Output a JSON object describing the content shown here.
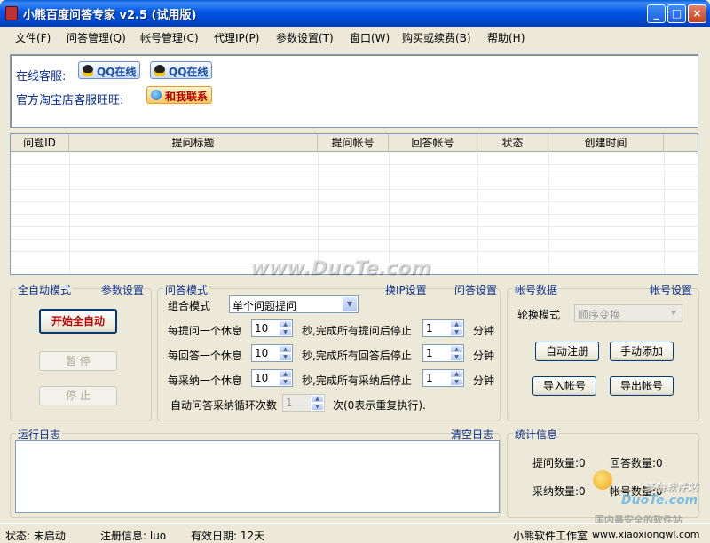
{
  "window": {
    "title": "小熊百度问答专家 v2.5 (试用版)",
    "minimize": "_",
    "maximize": "□",
    "close": "×"
  },
  "menu": [
    "文件(F)",
    "问答管理(Q)",
    "帐号管理(C)",
    "代理IP(P)",
    "参数设置(T)",
    "窗口(W)",
    "购买或续费(B)",
    "帮助(H)"
  ],
  "support": {
    "online_label": "在线客服:",
    "qq1": "QQ在线",
    "qq2": "QQ在线",
    "taobao_label": "官方淘宝店客服旺旺:",
    "wangwang": "和我联系"
  },
  "table": {
    "columns": [
      "问题ID",
      "提问标题",
      "提问帐号",
      "回答帐号",
      "状态",
      "创建时间"
    ]
  },
  "auto_mode": {
    "title": "全自动模式",
    "params_link": "参数设置",
    "start": "开始全自动",
    "pause": "暂  停",
    "stop": "停  止"
  },
  "qa_mode": {
    "title": "问答模式",
    "ip_link": "换IP设置",
    "qa_link": "问答设置",
    "combo_label": "组合模式",
    "combo_value": "单个问题提问",
    "rows": [
      {
        "label": "每提问一个休息",
        "value": "10",
        "mid": "秒,完成所有提问后停止",
        "value2": "1",
        "unit": "分钟"
      },
      {
        "label": "每回答一个休息",
        "value": "10",
        "mid": "秒,完成所有回答后停止",
        "value2": "1",
        "unit": "分钟"
      },
      {
        "label": "每采纳一个休息",
        "value": "10",
        "mid": "秒,完成所有采纳后停止",
        "value2": "1",
        "unit": "分钟"
      }
    ],
    "loop_label": "自动问答采纳循环次数",
    "loop_value": "1",
    "loop_suffix": "次(0表示重复执行)."
  },
  "account": {
    "title": "帐号数据",
    "settings_link": "帐号设置",
    "rotate_label": "轮换模式",
    "rotate_value": "顺序变换",
    "auto_register": "自动注册",
    "manual_add": "手动添加",
    "import": "导入帐号",
    "export": "导出帐号"
  },
  "log": {
    "title": "运行日志",
    "clear": "清空日志"
  },
  "stats": {
    "title": "统计信息",
    "ask": "提问数量:0",
    "answer": "回答数量:0",
    "adopt": "采纳数量:0",
    "accounts": "帐号数量:0"
  },
  "status": {
    "state": "状态: 未启动",
    "reg": "注册信息: luo",
    "valid": "有效日期: 12天",
    "studio": "小熊软件工作室",
    "url": "www.xiaoxiongwl.com"
  },
  "watermarks": {
    "center": "www.DuoTe.com",
    "logo": "DuoTe.com",
    "logo_cn": "多特软件站",
    "logo_sub": "国内最安全的软件站"
  }
}
